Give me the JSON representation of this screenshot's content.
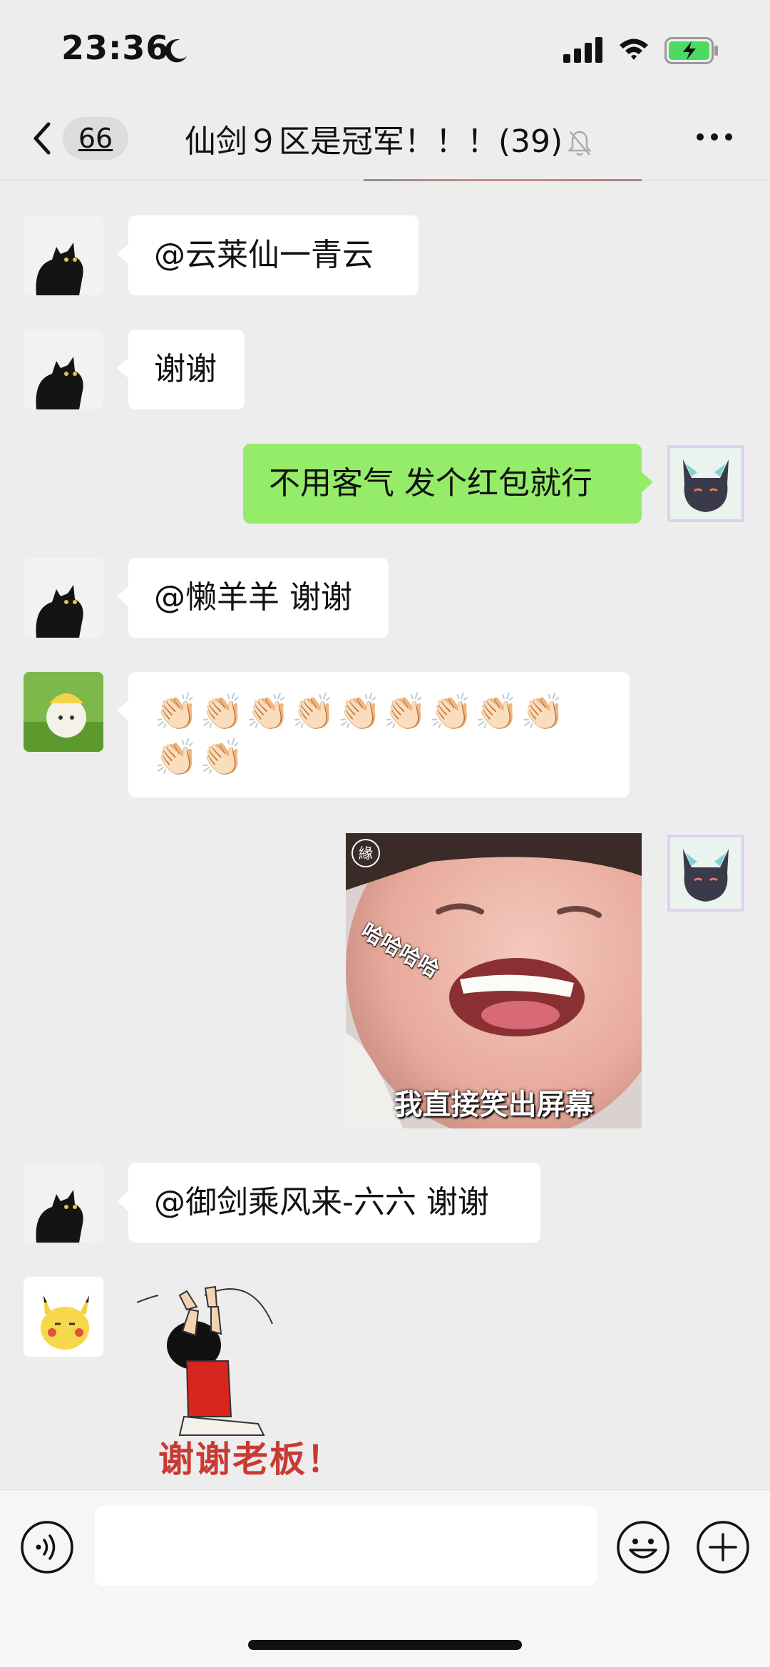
{
  "status_bar": {
    "time": "23:36",
    "icons": [
      "moon-icon",
      "signal-icon",
      "wifi-icon",
      "battery-charging-icon"
    ],
    "battery_color": "#4cd964"
  },
  "nav": {
    "unread_count": "66",
    "title": "仙剑９区是冠军！！！(39)",
    "icons": [
      "back-chevron-icon",
      "mute-bell-icon",
      "more-icon"
    ]
  },
  "messages": [
    {
      "direction": "in",
      "type": "text",
      "text": "@云莱仙一青云",
      "avatar": "black-cat-avatar"
    },
    {
      "direction": "in",
      "type": "text",
      "text": "谢谢",
      "avatar": "black-cat-avatar"
    },
    {
      "direction": "out",
      "type": "text",
      "text": "不用客气 发个红包就行",
      "avatar": "purple-cat-avatar"
    },
    {
      "direction": "in",
      "type": "text",
      "text": "@懒羊羊 谢谢",
      "avatar": "black-cat-avatar"
    },
    {
      "direction": "in",
      "type": "emoji",
      "text": "👏🏻👏🏻👏🏻👏🏻👏🏻👏🏻👏🏻👏🏻👏🏻👏🏻👏🏻",
      "avatar": "sheep-avatar"
    },
    {
      "direction": "out",
      "type": "image",
      "caption": "我直接笑出屏幕",
      "overlay_text": "哈哈哈哈",
      "badge": "緣",
      "avatar": "purple-cat-avatar"
    },
    {
      "direction": "in",
      "type": "text",
      "text": "@御剑乘风来-六六 谢谢",
      "avatar": "black-cat-avatar"
    },
    {
      "direction": "in",
      "type": "sticker",
      "text": "谢谢老板！",
      "avatar": "pikachu-avatar"
    }
  ],
  "input_bar": {
    "placeholder": "",
    "icons": [
      "voice-icon",
      "emoji-icon",
      "plus-icon"
    ]
  },
  "colors": {
    "background": "#ededed",
    "outgoing_bubble": "#95ec69",
    "incoming_bubble": "#ffffff"
  }
}
